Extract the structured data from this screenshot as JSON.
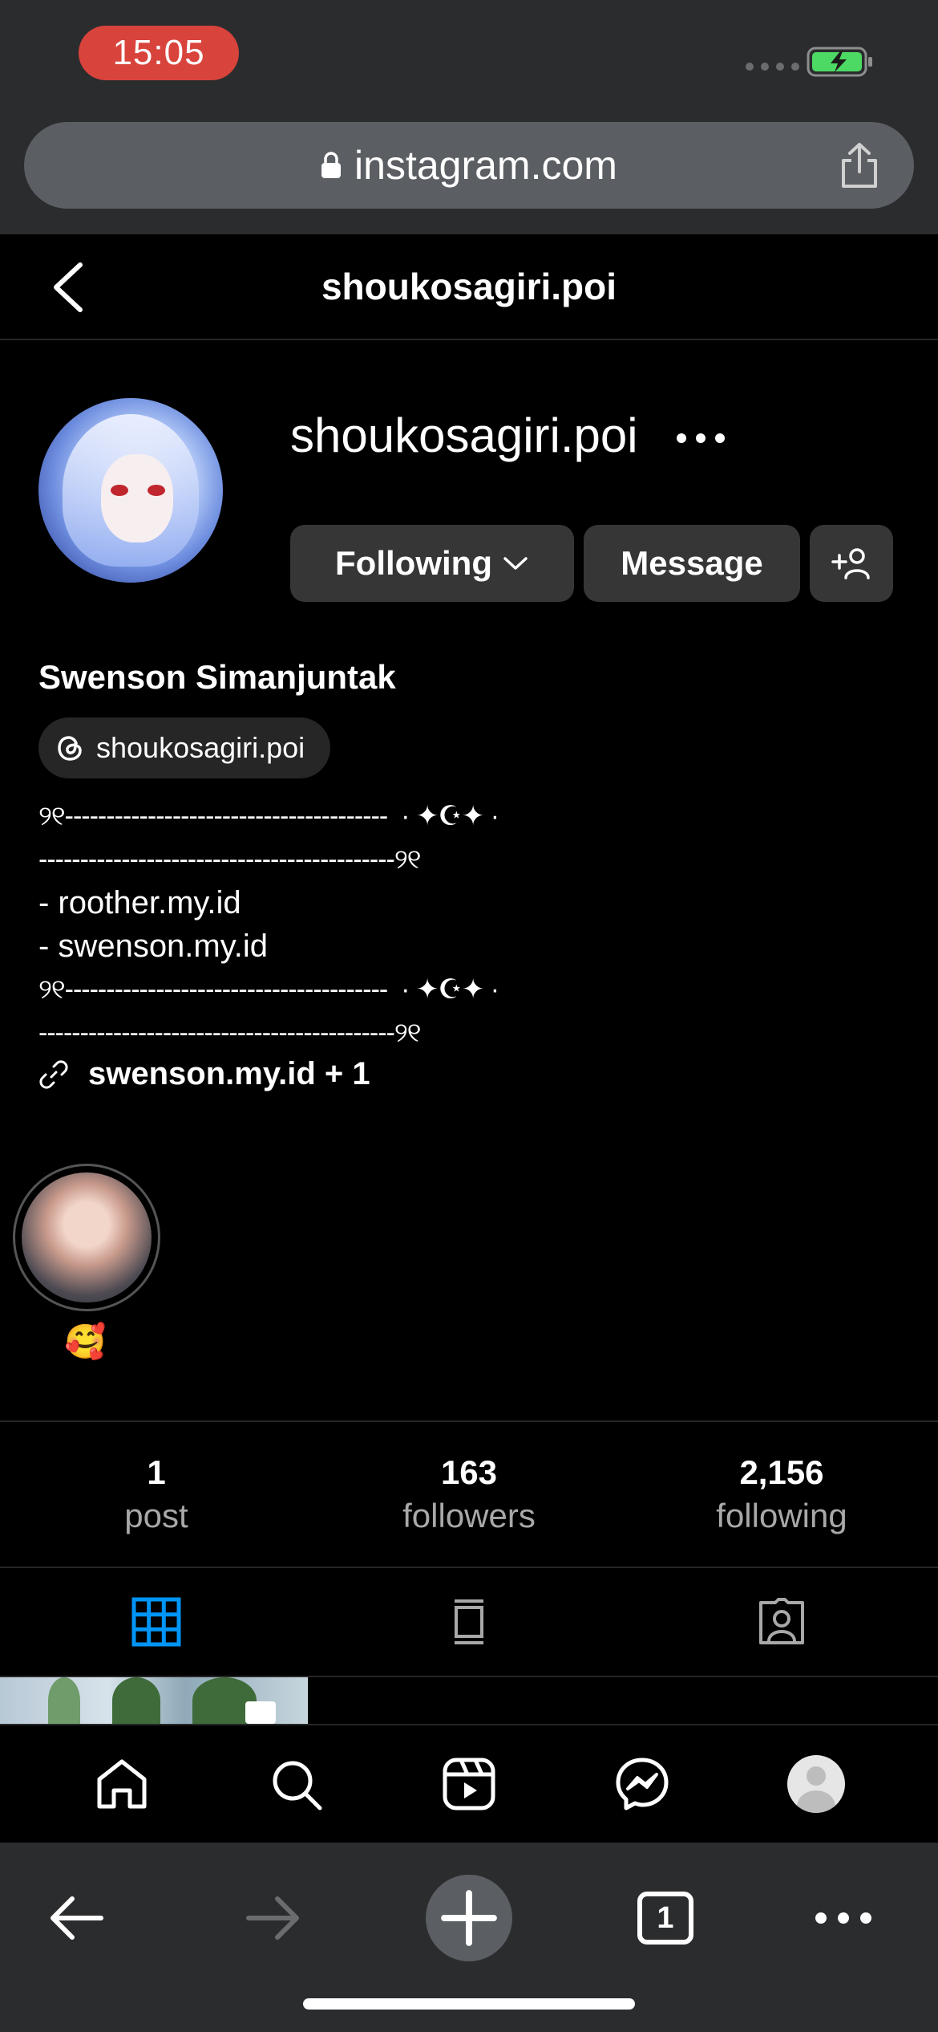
{
  "status_bar": {
    "time": "15:05"
  },
  "browser": {
    "url": "instagram.com"
  },
  "header": {
    "title": "shoukosagiri.poi"
  },
  "profile": {
    "username": "shoukosagiri.poi",
    "full_name": "Swenson Simanjuntak",
    "threads_handle": "shoukosagiri.poi",
    "buttons": {
      "following": "Following",
      "message": "Message"
    },
    "bio_lines": [
      "୨୧---------------------------------------  · ✦☪✦ ·",
      "-------------------------------------------୨୧",
      "- roother.my.id",
      "- swenson.my.id",
      "୨୧---------------------------------------  · ✦☪✦ ·",
      "-------------------------------------------୨୧"
    ],
    "link": "swenson.my.id + 1",
    "highlight_label": "🥰"
  },
  "stats": [
    {
      "value": "1",
      "label": "post"
    },
    {
      "value": "163",
      "label": "followers"
    },
    {
      "value": "2,156",
      "label": "following"
    }
  ],
  "bottom_chrome": {
    "tab_count": "1"
  },
  "colors": {
    "accent": "#0095f6",
    "time_pill": "#d8433c",
    "battery": "#4cd964"
  },
  "icons": [
    "back-icon",
    "more-icon",
    "chevron-down-icon",
    "add-user-icon",
    "threads-icon",
    "link-icon",
    "grid-icon",
    "reels-tab-icon",
    "tagged-icon",
    "home-icon",
    "search-icon",
    "reels-icon",
    "messenger-icon",
    "share-icon",
    "lock-icon"
  ]
}
